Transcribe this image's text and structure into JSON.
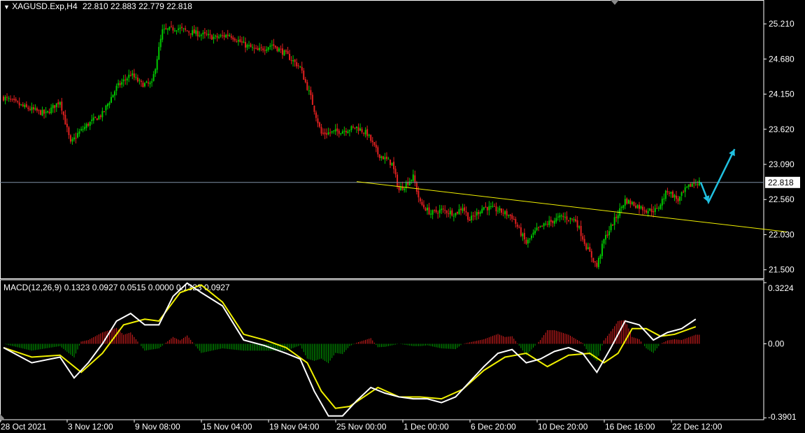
{
  "chart_data": [
    {
      "type": "candlestick",
      "title": "XAGUSD.Exp,H4",
      "ohlc_header": [
        "22.810",
        "22.883",
        "22.779",
        "22.818"
      ],
      "price_axis_ticks": [
        "25.210",
        "24.680",
        "24.150",
        "23.620",
        "23.090",
        "22.560",
        "22.030",
        "21.500"
      ],
      "ylim": [
        21.37,
        25.57
      ],
      "current_price": "22.818",
      "current_price_value": 22.818,
      "time_axis_labels": [
        "28 Oct 2021",
        "3 Nov 12:00",
        "9 Nov 08:00",
        "15 Nov 04:00",
        "19 Nov 04:00",
        "25 Nov 00:00",
        "1 Dec 00:00",
        "6 Dec 20:00",
        "10 Dec 20:00",
        "16 Dec 16:00",
        "22 Dec 12:00"
      ],
      "close_path": [
        [
          0,
          24.1
        ],
        [
          3,
          23.95
        ],
        [
          6,
          23.85
        ],
        [
          8,
          24.05
        ],
        [
          9.5,
          23.4
        ],
        [
          10.5,
          23.55
        ],
        [
          12,
          23.7
        ],
        [
          14,
          23.85
        ],
        [
          16,
          24.25
        ],
        [
          18,
          24.45
        ],
        [
          19.5,
          24.3
        ],
        [
          21,
          24.3
        ],
        [
          22.5,
          25.1
        ],
        [
          24.5,
          25.15
        ],
        [
          26,
          25.1
        ],
        [
          28,
          25.05
        ],
        [
          30,
          25.0
        ],
        [
          32,
          25.05
        ],
        [
          34,
          24.9
        ],
        [
          36,
          24.8
        ],
        [
          38,
          24.9
        ],
        [
          40,
          24.75
        ],
        [
          42,
          24.55
        ],
        [
          43.5,
          24.1
        ],
        [
          45,
          23.55
        ],
        [
          48,
          23.6
        ],
        [
          50,
          23.65
        ],
        [
          51.5,
          23.55
        ],
        [
          53,
          23.25
        ],
        [
          55,
          23.1
        ],
        [
          56,
          22.7
        ],
        [
          57,
          22.8
        ],
        [
          58,
          22.9
        ],
        [
          59,
          22.5
        ],
        [
          60.5,
          22.35
        ],
        [
          62,
          22.4
        ],
        [
          64,
          22.35
        ],
        [
          65,
          22.45
        ],
        [
          66,
          22.25
        ],
        [
          68,
          22.45
        ],
        [
          70,
          22.4
        ],
        [
          72,
          22.3
        ],
        [
          74,
          21.9
        ],
        [
          75.5,
          22.1
        ],
        [
          77,
          22.2
        ],
        [
          79,
          22.3
        ],
        [
          81,
          22.25
        ],
        [
          82.5,
          21.85
        ],
        [
          84,
          21.55
        ],
        [
          85,
          21.95
        ],
        [
          86.5,
          22.25
        ],
        [
          88,
          22.55
        ],
        [
          89,
          22.5
        ],
        [
          90,
          22.45
        ],
        [
          91,
          22.4
        ],
        [
          92.5,
          22.4
        ],
        [
          94,
          22.7
        ],
        [
          95.5,
          22.55
        ],
        [
          96.5,
          22.7
        ],
        [
          97.5,
          22.8
        ],
        [
          98.5,
          22.82
        ]
      ],
      "trendline": {
        "color": "#f0f000",
        "from": [
          50,
          22.83
        ],
        "to": [
          111,
          22.07
        ]
      },
      "projection_arrow": {
        "color": "#20c0e0",
        "points": [
          [
            98.7,
            22.82
          ],
          [
            99.8,
            22.52
          ],
          [
            103.5,
            23.32
          ]
        ]
      },
      "candle_colors": {
        "up": "#00c800",
        "down": "#e02020"
      }
    },
    {
      "type": "macd",
      "label": "MACD(12,26,9) 0.1323 0.0927 0.0515 0.0000 0.1323 0.0927",
      "value_axis_ticks": [
        "0.3224",
        "0.00",
        "-0.3901"
      ],
      "ylim": [
        -0.4,
        0.33
      ],
      "macd_line_color": "#ffffff",
      "signal_line_color": "#f0f000",
      "macd_line": [
        [
          0,
          -0.02
        ],
        [
          4,
          -0.1
        ],
        [
          8,
          -0.07
        ],
        [
          10,
          -0.18
        ],
        [
          12,
          -0.1
        ],
        [
          14,
          0.0
        ],
        [
          16,
          0.12
        ],
        [
          18,
          0.16
        ],
        [
          20,
          0.1
        ],
        [
          22,
          0.1
        ],
        [
          24,
          0.25
        ],
        [
          26,
          0.32
        ],
        [
          28,
          0.27
        ],
        [
          31,
          0.2
        ],
        [
          34,
          0.02
        ],
        [
          37,
          -0.01
        ],
        [
          40,
          -0.05
        ],
        [
          42,
          -0.08
        ],
        [
          44,
          -0.25
        ],
        [
          46,
          -0.38
        ],
        [
          48,
          -0.38
        ],
        [
          50,
          -0.3
        ],
        [
          52,
          -0.23
        ],
        [
          54,
          -0.26
        ],
        [
          56,
          -0.28
        ],
        [
          58,
          -0.29
        ],
        [
          60,
          -0.29
        ],
        [
          62,
          -0.31
        ],
        [
          64,
          -0.28
        ],
        [
          66,
          -0.2
        ],
        [
          68,
          -0.12
        ],
        [
          70,
          -0.05
        ],
        [
          72,
          -0.03
        ],
        [
          74,
          -0.1
        ],
        [
          76,
          -0.08
        ],
        [
          78,
          -0.04
        ],
        [
          80,
          -0.02
        ],
        [
          82,
          -0.05
        ],
        [
          84,
          -0.15
        ],
        [
          86,
          -0.02
        ],
        [
          88,
          0.12
        ],
        [
          90,
          0.1
        ],
        [
          92,
          0.02
        ],
        [
          94,
          0.06
        ],
        [
          96,
          0.08
        ],
        [
          98,
          0.13
        ]
      ],
      "signal_line": [
        [
          0,
          -0.02
        ],
        [
          4,
          -0.07
        ],
        [
          8,
          -0.06
        ],
        [
          11,
          -0.15
        ],
        [
          14,
          -0.05
        ],
        [
          17,
          0.1
        ],
        [
          20,
          0.13
        ],
        [
          22,
          0.12
        ],
        [
          25,
          0.27
        ],
        [
          28,
          0.31
        ],
        [
          31,
          0.22
        ],
        [
          34,
          0.05
        ],
        [
          37,
          0.02
        ],
        [
          40,
          -0.02
        ],
        [
          43,
          -0.1
        ],
        [
          45,
          -0.25
        ],
        [
          47,
          -0.34
        ],
        [
          49,
          -0.33
        ],
        [
          51,
          -0.28
        ],
        [
          53,
          -0.23
        ],
        [
          56,
          -0.28
        ],
        [
          59,
          -0.28
        ],
        [
          62,
          -0.29
        ],
        [
          65,
          -0.24
        ],
        [
          68,
          -0.14
        ],
        [
          71,
          -0.07
        ],
        [
          74,
          -0.05
        ],
        [
          77,
          -0.12
        ],
        [
          80,
          -0.06
        ],
        [
          83,
          -0.05
        ],
        [
          85,
          -0.1
        ],
        [
          87,
          -0.05
        ],
        [
          89,
          0.08
        ],
        [
          91,
          0.08
        ],
        [
          93,
          0.04
        ],
        [
          95,
          0.05
        ],
        [
          98,
          0.09
        ]
      ],
      "histogram_colors": {
        "positive": "#e02020",
        "negative": "#00a000"
      }
    }
  ]
}
